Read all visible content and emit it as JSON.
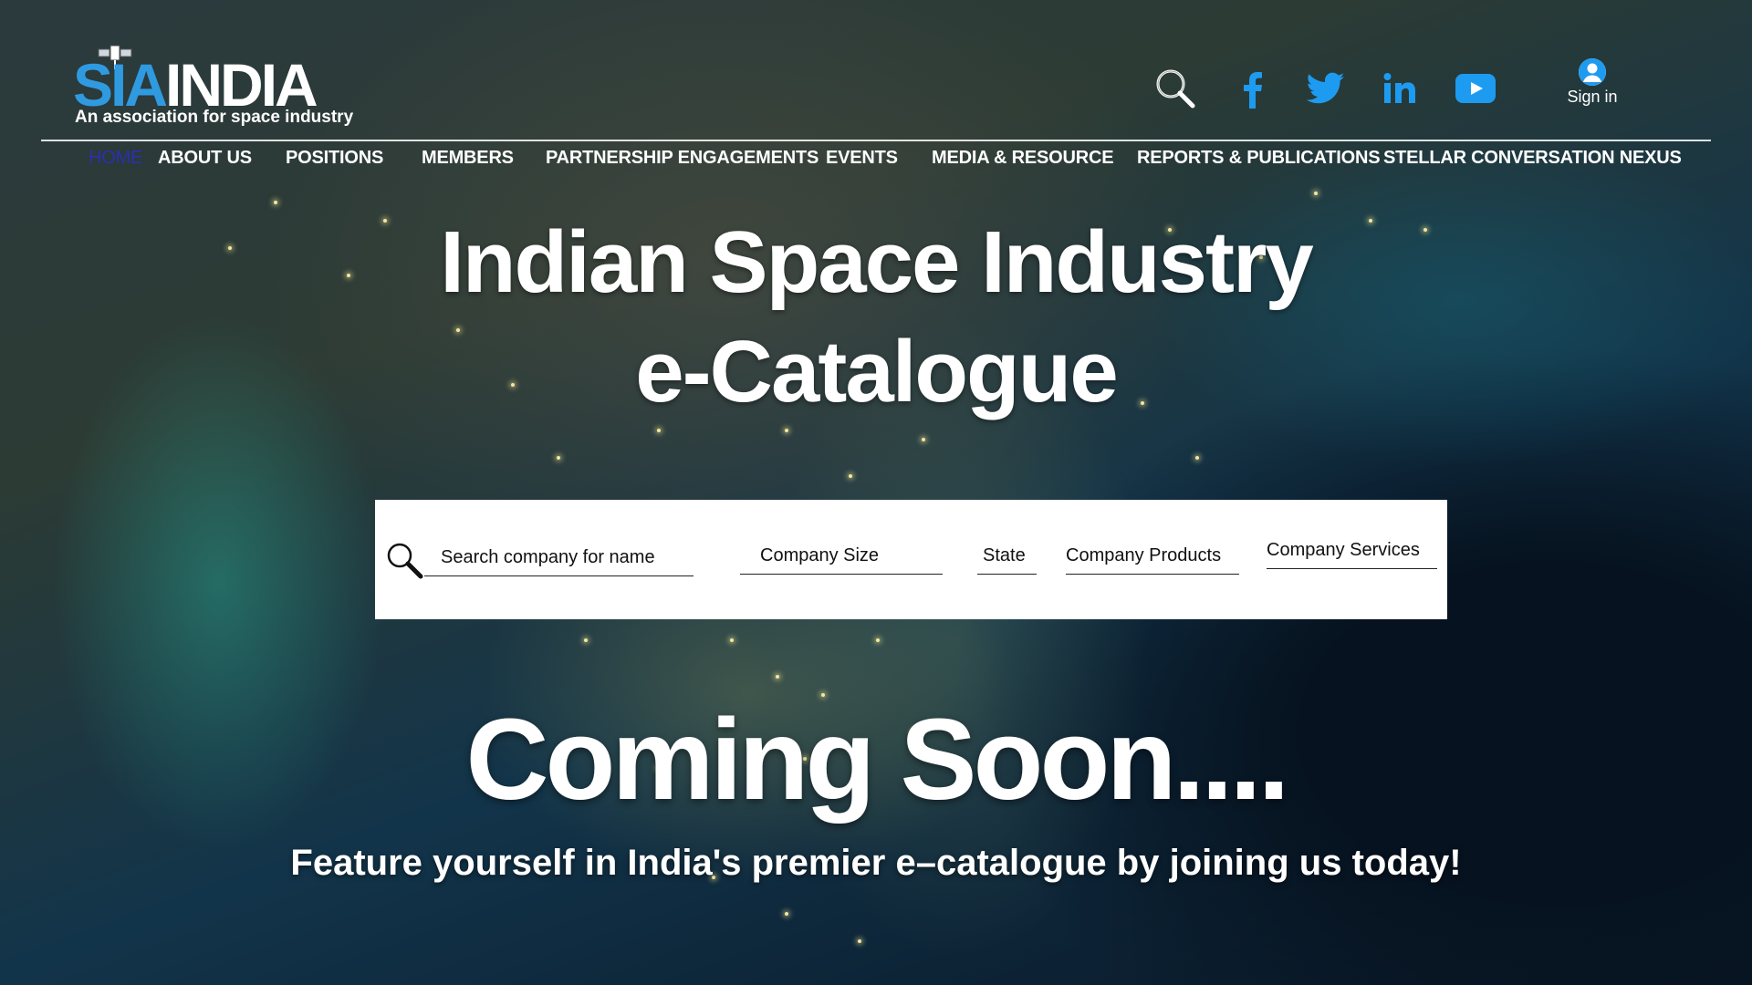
{
  "header": {
    "logo": {
      "brand_part1": "SIA",
      "brand_part2": "INDIA",
      "tagline": "An association for space industry"
    },
    "icons": [
      "search-icon",
      "facebook-icon",
      "twitter-icon",
      "linkedin-icon",
      "youtube-icon"
    ],
    "sign_in_label": "Sign in"
  },
  "nav": {
    "items": [
      {
        "label": "HOME",
        "active": true
      },
      {
        "label": "ABOUT US"
      },
      {
        "label": "POSITIONS"
      },
      {
        "label": "MEMBERS"
      },
      {
        "label": "PARTNERSHIP ENGAGEMENTS"
      },
      {
        "label": "EVENTS"
      },
      {
        "label": "MEDIA & RESOURCE"
      },
      {
        "label": "REPORTS & PUBLICATIONS"
      },
      {
        "label": "STELLAR CONVERSATION NEXUS"
      }
    ]
  },
  "hero": {
    "title_line1": "Indian Space Industry",
    "title_line2": "e-Catalogue"
  },
  "search": {
    "placeholder": "Search company for name",
    "filters": {
      "size": "Company Size",
      "state": "State",
      "products": "Company Products",
      "services": "Company Services"
    }
  },
  "status": {
    "coming_soon": "Coming Soon....",
    "tagline": "Feature yourself in India's premier e–catalogue by joining us today!"
  },
  "colors": {
    "accent_blue": "#2f9ae0",
    "active_nav": "#2b2fb0",
    "social_blue": "#1d9bf0"
  }
}
